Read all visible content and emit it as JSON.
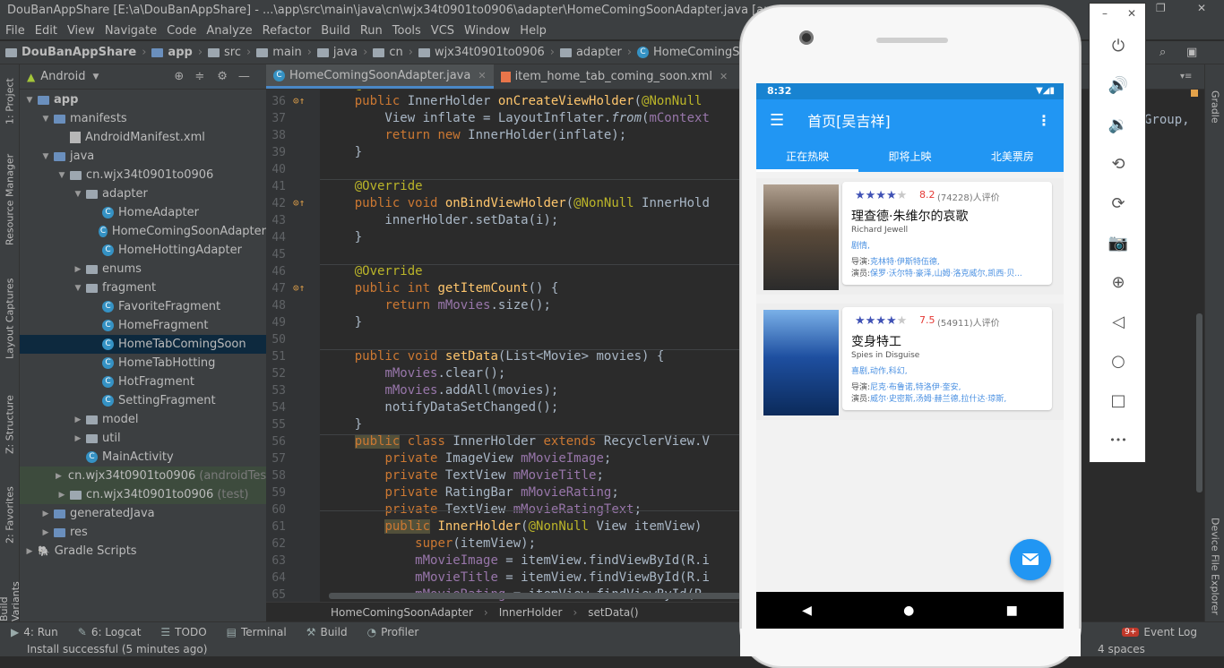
{
  "window": {
    "title": "DouBanAppShare [E:\\a\\DouBanAppShare] - ...\\app\\src\\main\\java\\cn\\wjx34t0901to0906\\adapter\\HomeComingSoonAdapter.java [app] - Android Studio"
  },
  "menu": [
    "File",
    "Edit",
    "View",
    "Navigate",
    "Code",
    "Analyze",
    "Refactor",
    "Build",
    "Run",
    "Tools",
    "VCS",
    "Window",
    "Help"
  ],
  "breadcrumbs": [
    "DouBanAppShare",
    "app",
    "src",
    "main",
    "java",
    "cn",
    "wjx34t0901to0906",
    "adapter",
    "HomeComingSoonAdapter"
  ],
  "left_tool_tabs": [
    "1: Project",
    "Resource Manager",
    "Layout Captures",
    "Z: Structure",
    "2: Favorites",
    "Build Variants"
  ],
  "project_view": {
    "mode": "Android"
  },
  "tree": [
    {
      "label": "app",
      "indent": 0,
      "type": "module",
      "open": true
    },
    {
      "label": "manifests",
      "indent": 1,
      "type": "folder",
      "open": true
    },
    {
      "label": "AndroidManifest.xml",
      "indent": 2,
      "type": "xml"
    },
    {
      "label": "java",
      "indent": 1,
      "type": "folder",
      "open": true
    },
    {
      "label": "cn.wjx34t0901to0906",
      "indent": 2,
      "type": "package",
      "open": true
    },
    {
      "label": "adapter",
      "indent": 3,
      "type": "package",
      "open": true
    },
    {
      "label": "HomeAdapter",
      "indent": 4,
      "type": "class"
    },
    {
      "label": "HomeComingSoonAdapter",
      "indent": 4,
      "type": "class"
    },
    {
      "label": "HomeHottingAdapter",
      "indent": 4,
      "type": "class"
    },
    {
      "label": "enums",
      "indent": 3,
      "type": "package",
      "open": false
    },
    {
      "label": "fragment",
      "indent": 3,
      "type": "package",
      "open": true
    },
    {
      "label": "FavoriteFragment",
      "indent": 4,
      "type": "class"
    },
    {
      "label": "HomeFragment",
      "indent": 4,
      "type": "class"
    },
    {
      "label": "HomeTabComingSoon",
      "indent": 4,
      "type": "class",
      "selected": true
    },
    {
      "label": "HomeTabHotting",
      "indent": 4,
      "type": "class"
    },
    {
      "label": "HotFragment",
      "indent": 4,
      "type": "class"
    },
    {
      "label": "SettingFragment",
      "indent": 4,
      "type": "class"
    },
    {
      "label": "model",
      "indent": 3,
      "type": "package",
      "open": false
    },
    {
      "label": "util",
      "indent": 3,
      "type": "package",
      "open": false
    },
    {
      "label": "MainActivity",
      "indent": 3,
      "type": "class"
    },
    {
      "label": "cn.wjx34t0901to0906",
      "suffix": "(androidTest)",
      "indent": 2,
      "type": "package",
      "open": false,
      "hl": true
    },
    {
      "label": "cn.wjx34t0901to0906",
      "suffix": "(test)",
      "indent": 2,
      "type": "package",
      "open": false,
      "hl": true
    },
    {
      "label": "generatedJava",
      "indent": 1,
      "type": "folder",
      "open": false
    },
    {
      "label": "res",
      "indent": 1,
      "type": "folder",
      "open": false
    },
    {
      "label": "Gradle Scripts",
      "indent": 0,
      "type": "gradle",
      "open": false
    }
  ],
  "editor_tabs": [
    {
      "label": "HomeComingSoonAdapter.java",
      "active": true
    },
    {
      "label": "item_home_tab_coming_soon.xml",
      "active": false
    }
  ],
  "code_lines": [
    {
      "n": "36",
      "mark": true,
      "html": "    <span class='kw'>public</span> InnerHolder <span class='fn'>onCreateViewHolder</span>(<span class='an'>@NonNull</span>"
    },
    {
      "n": "37",
      "html": "        View inflate = LayoutInflater.<span class='it'>from</span>(<span class='fd'>mContext</span>"
    },
    {
      "n": "38",
      "html": "        <span class='kw'>return new</span> InnerHolder(inflate);"
    },
    {
      "n": "39",
      "html": "    }"
    },
    {
      "n": "40",
      "html": ""
    },
    {
      "n": "41",
      "html": "    <span class='an'>@Override</span>"
    },
    {
      "n": "42",
      "mark": true,
      "html": "    <span class='kw'>public void</span> <span class='fn'>onBindViewHolder</span>(<span class='an'>@NonNull</span> InnerHold"
    },
    {
      "n": "43",
      "html": "        innerHolder.setData(i);"
    },
    {
      "n": "44",
      "html": "    }"
    },
    {
      "n": "45",
      "html": ""
    },
    {
      "n": "46",
      "html": "    <span class='an'>@Override</span>"
    },
    {
      "n": "47",
      "mark": true,
      "html": "    <span class='kw'>public int</span> <span class='fn'>getItemCount</span>() {"
    },
    {
      "n": "48",
      "html": "        <span class='kw'>return</span> <span class='fd'>mMovies</span>.size();"
    },
    {
      "n": "49",
      "html": "    }"
    },
    {
      "n": "50",
      "html": ""
    },
    {
      "n": "51",
      "html": "    <span class='kw'>public void</span> <span class='fn'>setData</span>(List&lt;Movie&gt; movies) {"
    },
    {
      "n": "52",
      "html": "        <span class='fd'>mMovies</span>.clear();"
    },
    {
      "n": "53",
      "html": "        <span class='fd'>mMovies</span>.addAll(movies);"
    },
    {
      "n": "54",
      "html": "        notifyDataSetChanged();"
    },
    {
      "n": "55",
      "html": "    }"
    },
    {
      "n": "56",
      "html": "    <span class='kw' style='background:#52503a'>public</span> <span class='kw'>class</span> InnerHolder <span class='kw'>extends</span> RecyclerView.V"
    },
    {
      "n": "57",
      "html": "        <span class='kw'>private</span> ImageView <span class='fd'>mMovieImage</span>;"
    },
    {
      "n": "58",
      "html": "        <span class='kw'>private</span> TextView <span class='fd'>mMovieTitle</span>;"
    },
    {
      "n": "59",
      "html": "        <span class='kw'>private</span> RatingBar <span class='fd'>mMovieRating</span>;"
    },
    {
      "n": "60",
      "html": "        <span class='kw'>private</span> TextView <span class='fd'>mMovieRatingText</span>;"
    },
    {
      "n": "61",
      "html": "        <span class='kw' style='background:#52503a'>public</span> <span class='fn'>InnerHolder</span>(<span class='an'>@NonNull</span> View itemView)"
    },
    {
      "n": "62",
      "html": "            <span class='kw'>super</span>(itemView);"
    },
    {
      "n": "63",
      "html": "            <span class='fd'>mMovieImage</span> = itemView.findViewById(R.i"
    },
    {
      "n": "64",
      "html": "            <span class='fd'>mMovieTitle</span> = itemView.findViewById(R.i"
    },
    {
      "n": "65",
      "html": "            <span class='fd'>mMovieRating</span> = itemView.findViewById(R."
    }
  ],
  "code_partial_top": "    @Override",
  "code_right_fragment": "Group,",
  "editor_breadcrumb": [
    "HomeComingSoonAdapter",
    "InnerHolder",
    "setData()"
  ],
  "bottom_tools": [
    {
      "icon": "run-icon",
      "label": "4: Run"
    },
    {
      "icon": "logcat-icon",
      "label": "6: Logcat"
    },
    {
      "icon": "todo-icon",
      "label": "TODO"
    },
    {
      "icon": "terminal-icon",
      "label": "Terminal"
    },
    {
      "icon": "build-icon",
      "label": "Build"
    },
    {
      "icon": "profiler-icon",
      "label": "Profiler"
    }
  ],
  "event_log": {
    "badge": "9+",
    "label": "Event Log"
  },
  "status": {
    "message": "Install successful (5 minutes ago)",
    "indent": "4 spaces"
  },
  "right_tool_tabs": [
    "Gradle",
    "Device File Explorer"
  ],
  "phone": {
    "time": "8:32",
    "title": "首页[吴吉祥]",
    "tabs": [
      "正在热映",
      "即将上映",
      "北美票房"
    ],
    "active_tab": 0,
    "movies": [
      {
        "rating": "8.2",
        "count": "(74228)人评价",
        "stars": 4,
        "title": "理查德·朱维尔的哀歌",
        "subtitle": "Richard Jewell",
        "genre": "剧情,",
        "director_label": "导演:",
        "director": "克林特·伊斯特伍德,",
        "cast_label": "演员:",
        "cast": "保罗·沃尔特·豪泽,山姆·洛克威尔,凯西·贝..."
      },
      {
        "rating": "7.5",
        "count": "(54911)人评价",
        "stars": 4,
        "title": "变身特工",
        "subtitle": "Spies in Disguise",
        "genre": "喜剧,动作,科幻,",
        "director_label": "导演:",
        "director": "尼克·布鲁诺,特洛伊·奎安,",
        "cast_label": "演员:",
        "cast": "威尔·史密斯,汤姆·赫兰德,拉什达·琼斯,"
      }
    ]
  },
  "emulator_controls": [
    "power-icon",
    "volume-up-icon",
    "volume-down-icon",
    "rotate-left-icon",
    "rotate-right-icon",
    "camera-icon",
    "zoom-icon",
    "back-icon",
    "home-icon",
    "overview-icon",
    "more-icon"
  ],
  "colors": {
    "accent": "#2196f3",
    "ide_bg": "#2b2b2b",
    "panel": "#3c3f41",
    "selection": "#0d293e"
  }
}
